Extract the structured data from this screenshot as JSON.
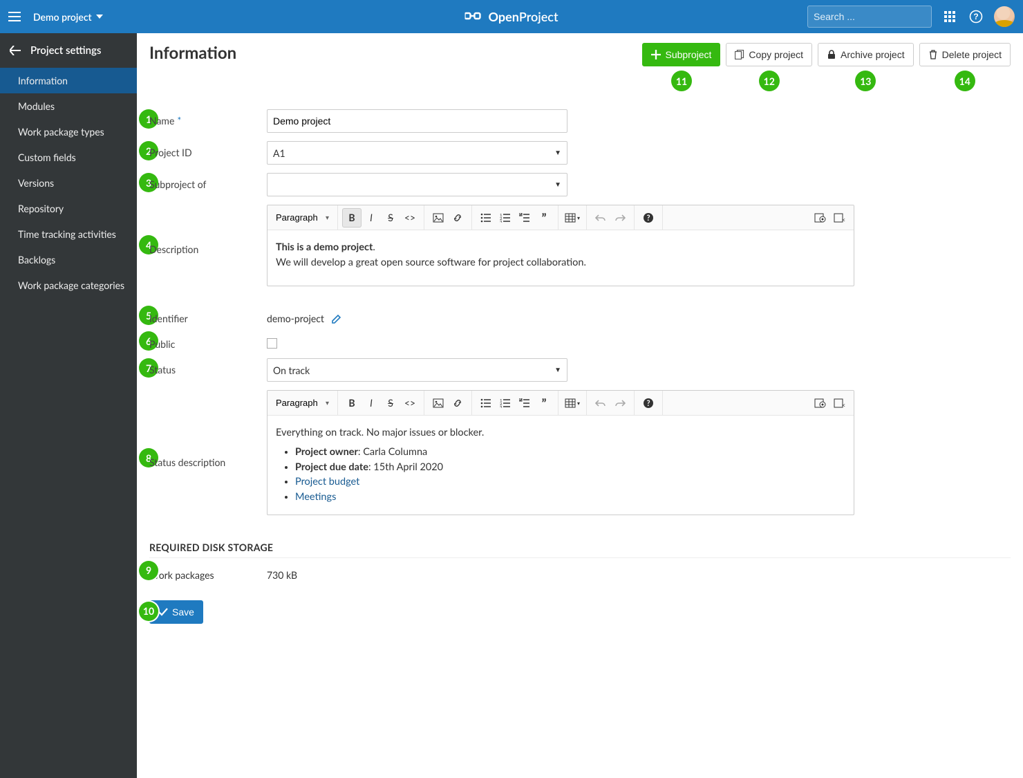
{
  "topbar": {
    "project_name": "Demo project",
    "brand_bold": "Open",
    "brand_rest": "Project",
    "search_placeholder": "Search ..."
  },
  "sidebar": {
    "title": "Project settings",
    "items": [
      "Information",
      "Modules",
      "Work package types",
      "Custom fields",
      "Versions",
      "Repository",
      "Time tracking activities",
      "Backlogs",
      "Work package categories"
    ]
  },
  "page": {
    "title": "Information",
    "actions": {
      "subproject": "Subproject",
      "copy": "Copy project",
      "archive": "Archive project",
      "delete": "Delete project"
    }
  },
  "form": {
    "labels": {
      "name": "Name",
      "project_id": "Project ID",
      "subproject_of": "Subproject of",
      "description": "Description",
      "identifier": "Identifier",
      "public": "Public",
      "status": "Status",
      "status_description": "Status description"
    },
    "name_value": "Demo project",
    "project_id_value": "A1",
    "subproject_of_value": "",
    "description": {
      "line1_bold": "This is a demo project",
      "line1_rest": ".",
      "line2": "We will develop a great open source software for project collaboration."
    },
    "identifier_value": "demo-project",
    "public_checked": false,
    "status_value": "On track",
    "status_desc": {
      "intro": "Everything on track. No major issues or blocker.",
      "owner_label": "Project owner",
      "owner_value": ": Carla Columna",
      "due_label": "Project due date",
      "due_value": ": 15th April 2020",
      "link_budget": "Project budget",
      "link_meetings": "Meetings"
    },
    "editor_paragraph": "Paragraph"
  },
  "storage": {
    "heading": "REQUIRED DISK STORAGE",
    "label": "Work packages",
    "value": "730 kB"
  },
  "save_label": "Save",
  "annotations": {
    "1": "1",
    "2": "2",
    "3": "3",
    "4": "4",
    "5": "5",
    "6": "6",
    "7": "7",
    "8": "8",
    "9": "9",
    "10": "10",
    "11": "11",
    "12": "12",
    "13": "13",
    "14": "14"
  }
}
